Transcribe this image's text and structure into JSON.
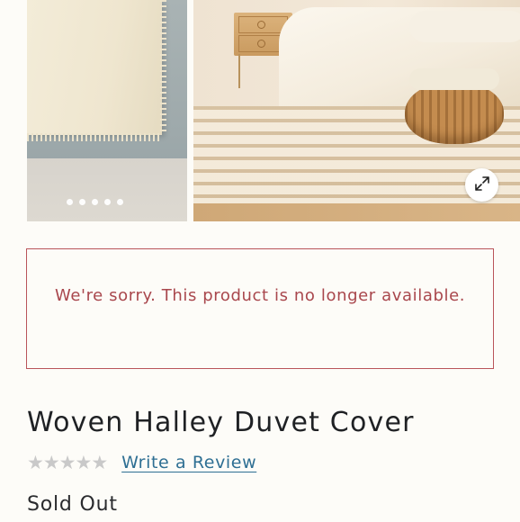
{
  "gallery": {
    "images": [
      "duvet-cover-detail-photo",
      "bedroom-scene-photo"
    ],
    "dot_count": 5,
    "expand_icon": "expand-arrows-icon"
  },
  "alert": {
    "message": "We're sorry. This product is no longer available.",
    "border_color": "#b9545a",
    "text_color": "#a9474d"
  },
  "product": {
    "title": "Woven Halley Duvet Cover",
    "rating": 0,
    "max_rating": 5,
    "review_link": "Write a Review",
    "status": "Sold Out"
  },
  "colors": {
    "link": "#2e6f93",
    "star_empty": "#c9c9c9",
    "background": "#fdfcf8"
  }
}
